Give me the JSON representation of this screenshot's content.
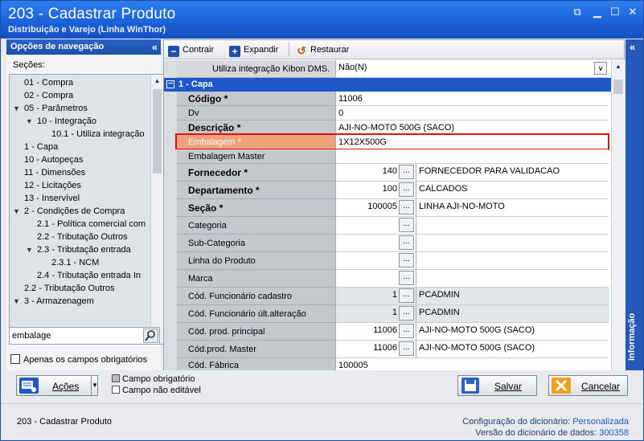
{
  "window": {
    "title": "203 - Cadastrar  Produto",
    "subtitle": "Distribuição e Varejo (Linha WinThor)"
  },
  "nav": {
    "header": "Opções de navegação",
    "collapse": "«",
    "sections_label": "Seções:",
    "items": [
      {
        "label": "01 - Compra",
        "level": 0,
        "arrow": ""
      },
      {
        "label": "02 - Compra",
        "level": 0,
        "arrow": ""
      },
      {
        "label": "05 - Parâmetros",
        "level": 0,
        "arrow": "v"
      },
      {
        "label": "10 - Integração",
        "level": 1,
        "arrow": "v"
      },
      {
        "label": "10.1 - Utiliza integração",
        "level": 2,
        "arrow": ""
      },
      {
        "label": "1 - Capa",
        "level": 0,
        "arrow": ""
      },
      {
        "label": "10 - Autopeças",
        "level": 0,
        "arrow": ""
      },
      {
        "label": "11 - Dimensões",
        "level": 0,
        "arrow": ""
      },
      {
        "label": "12 - Licitações",
        "level": 0,
        "arrow": ""
      },
      {
        "label": "13 - Inservível",
        "level": 0,
        "arrow": ""
      },
      {
        "label": "2 - Condições de Compra",
        "level": 0,
        "arrow": "v"
      },
      {
        "label": "2.1 - Política comercial com",
        "level": 1,
        "arrow": ""
      },
      {
        "label": "2.2 - Tributação Outros",
        "level": 1,
        "arrow": ""
      },
      {
        "label": "2.3 - Tributação entrada",
        "level": 1,
        "arrow": "v"
      },
      {
        "label": "2.3.1 - NCM",
        "level": 2,
        "arrow": ""
      },
      {
        "label": "2.4 - Tributação entrada In",
        "level": 1,
        "arrow": ""
      },
      {
        "label": "2.2 - Tributação Outros",
        "level": 0,
        "arrow": ""
      },
      {
        "label": "3 - Armazenagem",
        "level": 0,
        "arrow": "v"
      }
    ],
    "search_value": "embalage",
    "only_required": "Apenas os campos obrigatórios"
  },
  "toolbar": {
    "contrair": "Contrair",
    "expandir": "Expandir",
    "restaurar": "Restaurar"
  },
  "grid": {
    "top_row": {
      "label": "Utiliza integração Kibon DMS.",
      "value": "Não(N)"
    },
    "section": "1 - Capa",
    "rows": [
      {
        "label": "Código *",
        "bold": true,
        "value": "11006",
        "type": "text"
      },
      {
        "label": "Dv",
        "bold": false,
        "value": "0",
        "type": "text"
      },
      {
        "label": "Descrição *",
        "bold": true,
        "value": "AJI-NO-MOTO 500G (SACO)",
        "type": "text"
      },
      {
        "label": "Embalagem *",
        "bold": false,
        "value": "1X12X500G",
        "type": "highlight"
      },
      {
        "label": "Embalagem Master",
        "bold": false,
        "value": "",
        "type": "text"
      },
      {
        "label": "Fornecedor *",
        "bold": true,
        "num": "140",
        "desc": "FORNECEDOR PARA VALIDACAO",
        "type": "lookup"
      },
      {
        "label": "Departamento *",
        "bold": true,
        "num": "100",
        "desc": "CALCADOS",
        "type": "lookup"
      },
      {
        "label": "Seção *",
        "bold": true,
        "num": "100005",
        "desc": "LINHA AJI-NO-MOTO",
        "type": "lookup"
      },
      {
        "label": "Categoria",
        "bold": false,
        "num": "",
        "desc": "",
        "type": "lookup"
      },
      {
        "label": "Sub-Categoria",
        "bold": false,
        "num": "",
        "desc": "",
        "type": "lookup"
      },
      {
        "label": "Linha do Produto",
        "bold": false,
        "num": "",
        "desc": "",
        "type": "lookup"
      },
      {
        "label": "Marca",
        "bold": false,
        "num": "",
        "desc": "",
        "type": "lookup"
      },
      {
        "label": "Cód. Funcionário cadastro",
        "bold": false,
        "num": "1",
        "desc": "PCADMIN",
        "type": "lookup-ro"
      },
      {
        "label": "Cód. Funcionário últ.alteração",
        "bold": false,
        "num": "1",
        "desc": "PCADMIN",
        "type": "lookup-ro"
      },
      {
        "label": "Cód. prod. principal",
        "bold": false,
        "num": "11006",
        "desc": "AJI-NO-MOTO 500G (SACO)",
        "type": "lookup"
      },
      {
        "label": "Cód.prod. Master",
        "bold": false,
        "num": "11006",
        "desc": "AJI-NO-MOTO 500G (SACO)",
        "type": "lookup"
      },
      {
        "label": "Cód. Fábrica",
        "bold": false,
        "value": "100005",
        "type": "text"
      }
    ],
    "dots": "..."
  },
  "info": {
    "label": "Informação",
    "collapse": "«"
  },
  "buttons": {
    "acoes": "Ações",
    "salvar": "Salvar",
    "cancelar": "Cancelar"
  },
  "legend": {
    "required": "Campo obrigatório",
    "readonly": "Campo não editável"
  },
  "footer": {
    "left": "203 - Cadastrar  Produto",
    "dict_label": "Configuração do dicionário:",
    "dict_value": "Personalizada",
    "version_label": "Versão do dicionário de dados:",
    "version_value": "300358"
  }
}
